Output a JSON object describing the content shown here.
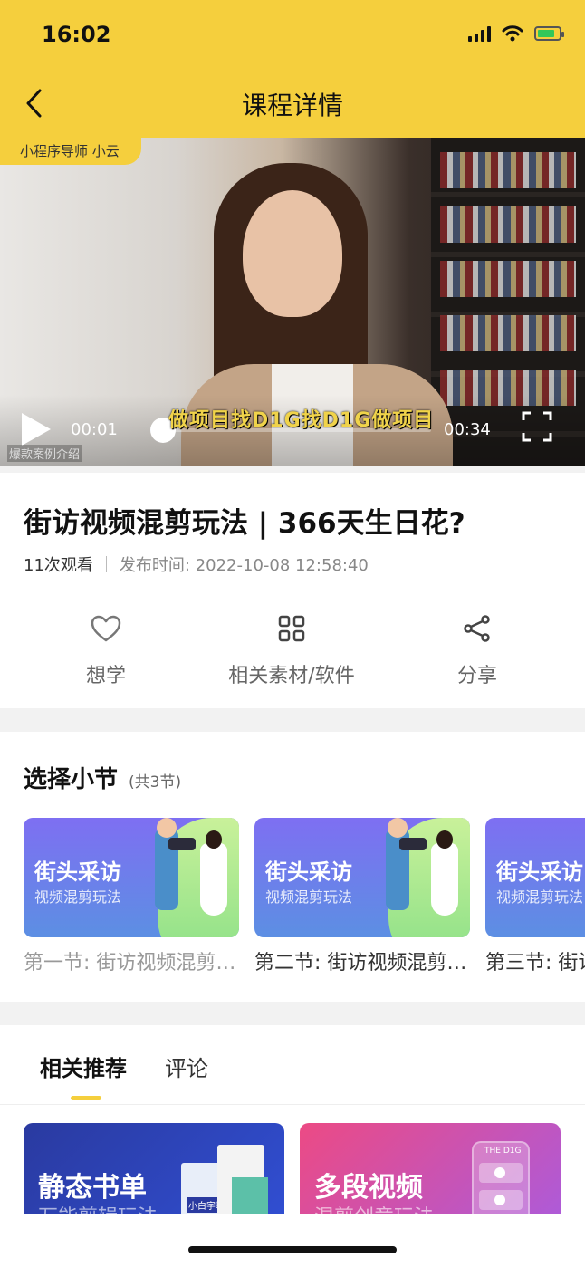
{
  "status_bar": {
    "time": "16:02"
  },
  "nav": {
    "title": "课程详情"
  },
  "video": {
    "badge": "小程序导师 小云",
    "current_time": "00:01",
    "total_time": "00:34",
    "subtitle": "做项目找D1G找D1G做项目",
    "watermark": "爆款案例介绍",
    "progress": 0.03
  },
  "course": {
    "title": "街访视频混剪玩法 | 366天生日花?",
    "views": "11次观看",
    "publish": "发布时间: 2022-10-08 12:58:40"
  },
  "actions": [
    {
      "label": "想学",
      "icon": "heart-icon"
    },
    {
      "label": "相关素材/软件",
      "icon": "grid-icon"
    },
    {
      "label": "分享",
      "icon": "share-icon"
    }
  ],
  "sections": {
    "title": "选择小节",
    "count": "(共3节)",
    "items": [
      {
        "thumb_title": "街头采访",
        "thumb_sub": "视频混剪玩法",
        "label": "第一节: 街访视频混剪玩法",
        "state": "muted"
      },
      {
        "thumb_title": "街头采访",
        "thumb_sub": "视频混剪玩法",
        "label": "第二节: 街访视频混剪玩法",
        "state": "strong"
      },
      {
        "thumb_title": "街头采访",
        "thumb_sub": "视频混剪玩法",
        "label": "第三节: 街访视频混剪玩法",
        "state": "strong"
      }
    ]
  },
  "tabs": [
    {
      "label": "相关推荐",
      "active": true
    },
    {
      "label": "评论",
      "active": false
    }
  ],
  "recommendations": [
    {
      "title": "静态书单",
      "subtitle": "万能剪辑玩法",
      "book_label": "小白字幕"
    },
    {
      "title": "多段视频",
      "subtitle": "混剪创意玩法",
      "phone_label": "THE D1G"
    }
  ]
}
